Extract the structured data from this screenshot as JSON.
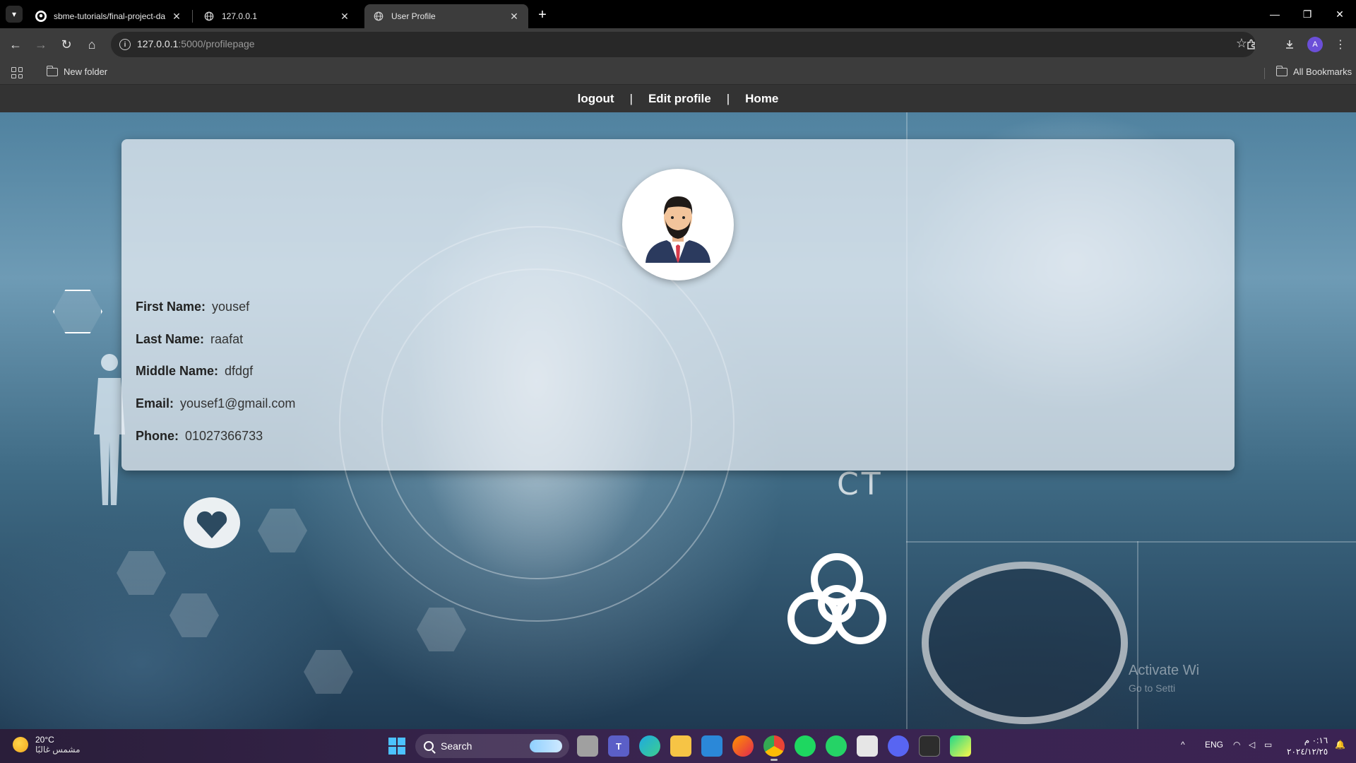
{
  "browser": {
    "tabs": [
      {
        "title": "sbme-tutorials/final-project-da",
        "icon": "github-icon",
        "active": false
      },
      {
        "title": "127.0.0.1",
        "icon": "globe-icon",
        "active": false
      },
      {
        "title": "User Profile",
        "icon": "globe-icon",
        "active": true
      }
    ],
    "url_host": "127.0.0.1",
    "url_rest": ":5000/profilepage",
    "bookmarks": [
      {
        "label": "New folder",
        "icon": "folder-icon"
      },
      {
        "label": "All Bookmarks",
        "icon": "folder-icon"
      }
    ],
    "profile_initial": "A"
  },
  "site_nav": {
    "logout": "logout",
    "edit_profile": "Edit profile",
    "home": "Home",
    "separator": "|"
  },
  "profile": {
    "fields": [
      {
        "label": "First Name:",
        "value": "yousef"
      },
      {
        "label": "Last Name:",
        "value": "raafat"
      },
      {
        "label": "Middle Name:",
        "value": "dfdgf"
      },
      {
        "label": "Email:",
        "value": "yousef1@gmail.com"
      },
      {
        "label": "Phone:",
        "value": "01027366733"
      }
    ]
  },
  "background": {
    "ct_label": "CT",
    "watermark_title": "Activate Wi",
    "watermark_sub": "Go to Setti"
  },
  "taskbar": {
    "temperature": "20°C",
    "weather_text": "مشمس غالبًا",
    "search_placeholder": "Search",
    "language": "ENG",
    "time": "٠:١٦ م",
    "date": "٢٠٢٤/١٢/٢٥",
    "accent_color": "#4cc2ff"
  }
}
